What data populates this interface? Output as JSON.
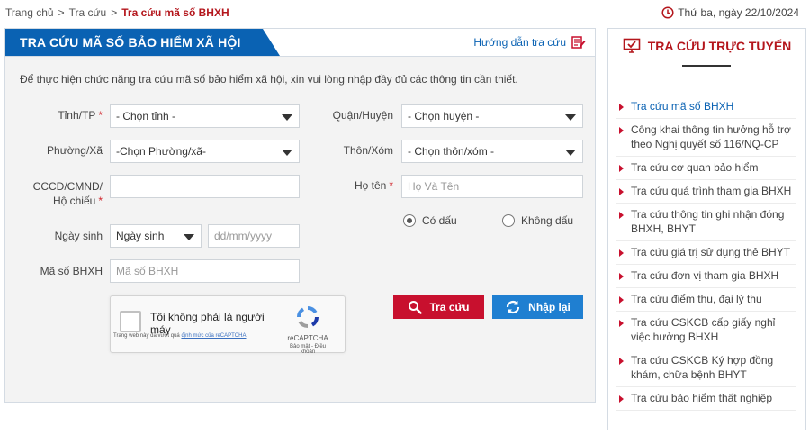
{
  "breadcrumb": {
    "items": [
      "Trang chủ",
      "Tra cứu"
    ],
    "separator": ">",
    "current": "Tra cứu mã số BHXH"
  },
  "date_text": "Thứ ba, ngày 22/10/2024",
  "panel": {
    "title": "TRA CỨU MÃ SỐ BẢO HIỂM XÃ HỘI",
    "guide_link": "Hướng dẫn tra cứu",
    "intro": "Để thực hiện chức năng tra cứu mã số bảo hiểm xã hội, xin vui lòng nhập đầy đủ các thông tin cần thiết."
  },
  "form": {
    "province": {
      "label": "Tỉnh/TP",
      "value": "- Chọn tỉnh -"
    },
    "district": {
      "label": "Quận/Huyện",
      "value": "- Chọn huyện -"
    },
    "ward": {
      "label": "Phường/Xã",
      "value": "-Chọn Phường/xã-"
    },
    "village": {
      "label": "Thôn/Xóm",
      "value": "- Chọn thôn/xóm -"
    },
    "id_number": {
      "label_line1": "CCCD/CMND/",
      "label_line2": "Hộ chiếu",
      "value": ""
    },
    "full_name": {
      "label": "Họ tên",
      "placeholder": "Họ Và Tên"
    },
    "accent_option_1": "Có dấu",
    "accent_option_2": "Không dấu",
    "dob": {
      "label": "Ngày sinh",
      "type_value": "Ngày sinh",
      "placeholder": "dd/mm/yyyy"
    },
    "bhxh_code": {
      "label": "Mã số BHXH",
      "placeholder": "Mã số BHXH"
    },
    "required_mark": "*"
  },
  "captcha": {
    "text": "Tôi không phải là người máy",
    "brand": "reCAPTCHA",
    "terms": "Bảo mật - Điều khoản",
    "note_prefix": "Trang web này đã vượt quá ",
    "note_link": "định mức của reCAPTCHA"
  },
  "buttons": {
    "search": "Tra cứu",
    "reset": "Nhập lại"
  },
  "sidebar": {
    "title": "TRA CỨU TRỰC TUYẾN",
    "items": [
      "Tra cứu mã số BHXH",
      "Công khai thông tin hưởng hỗ trợ theo Nghị quyết số 116/NQ-CP",
      "Tra cứu cơ quan bảo hiểm",
      "Tra cứu quá trình tham gia BHXH",
      "Tra cứu thông tin ghi nhận đóng BHXH, BHYT",
      "Tra cứu giá trị sử dụng thẻ BHYT",
      "Tra cứu đơn vị tham gia BHXH",
      "Tra cứu điểm thu, đại lý thu",
      "Tra cứu CSKCB cấp giấy nghỉ việc hưởng BHXH",
      "Tra cứu CSKCB Ký hợp đồng khám, chữa bệnh BHYT",
      "Tra cứu bảo hiểm thất nghiệp"
    ]
  },
  "colors": {
    "brand_blue": "#0a62b3",
    "brand_red": "#c8102e",
    "reset_blue": "#1f7fd1"
  }
}
